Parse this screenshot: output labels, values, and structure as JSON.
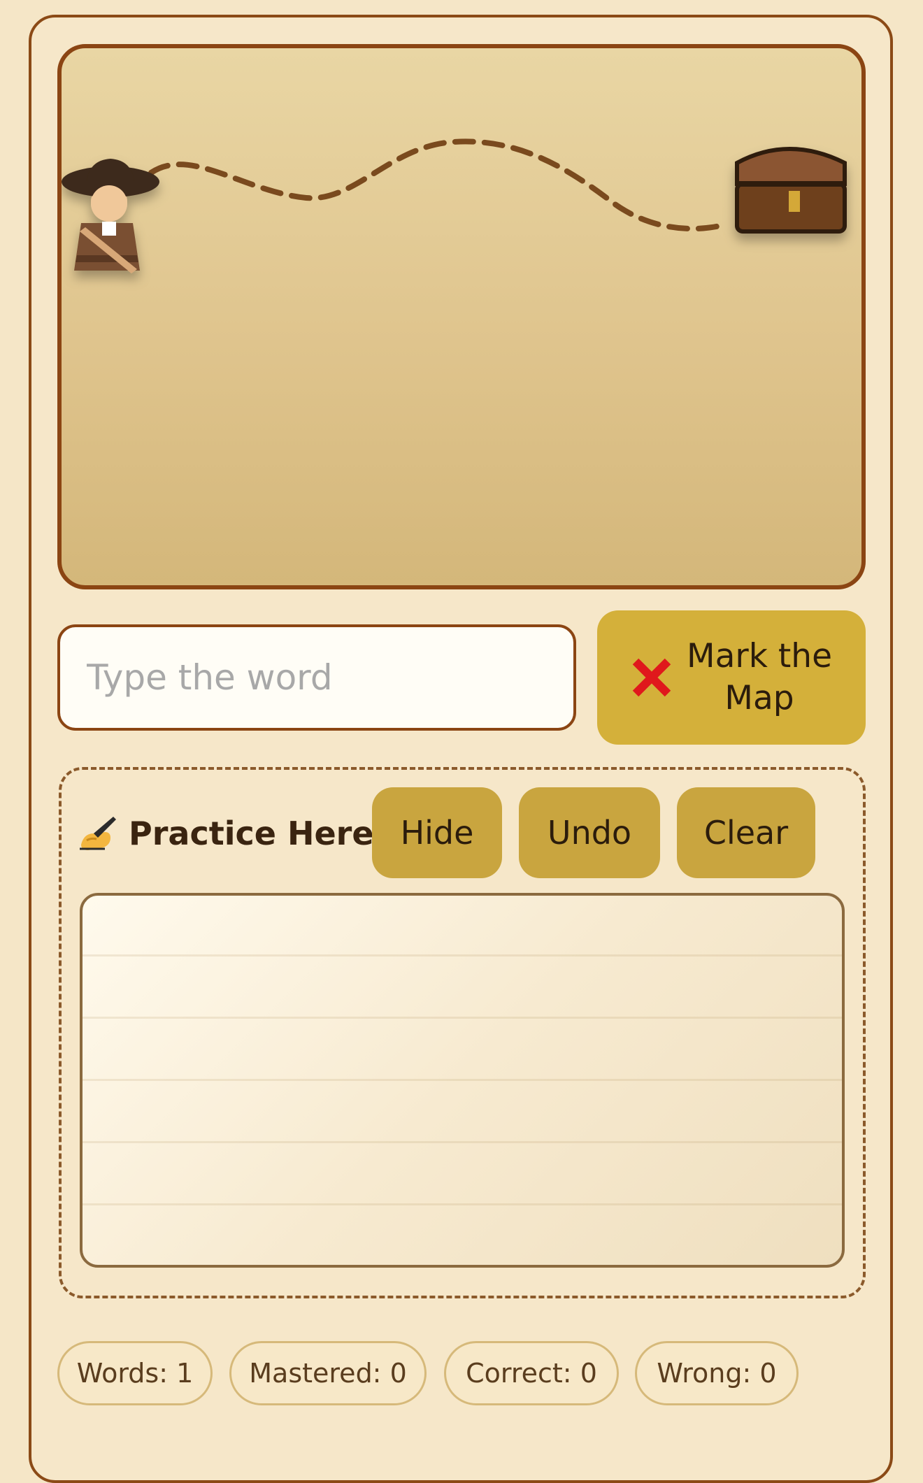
{
  "input": {
    "placeholder": "Type the word",
    "value": ""
  },
  "mark_button": {
    "icon": "x-icon",
    "label": "Mark the Map",
    "color": "#d4b03a"
  },
  "practice": {
    "icon": "writing-hand-icon",
    "title": "Practice Here",
    "buttons": {
      "hide": "Hide",
      "undo": "Undo",
      "clear": "Clear"
    }
  },
  "stats": {
    "words": "Words: 1",
    "mastered": "Mastered: 0",
    "correct": "Correct: 0",
    "wrong": "Wrong: 0"
  },
  "map": {
    "explorer_icon": "explorer-icon",
    "chest_icon": "treasure-chest-icon",
    "path_color": "#7a4a1e"
  }
}
